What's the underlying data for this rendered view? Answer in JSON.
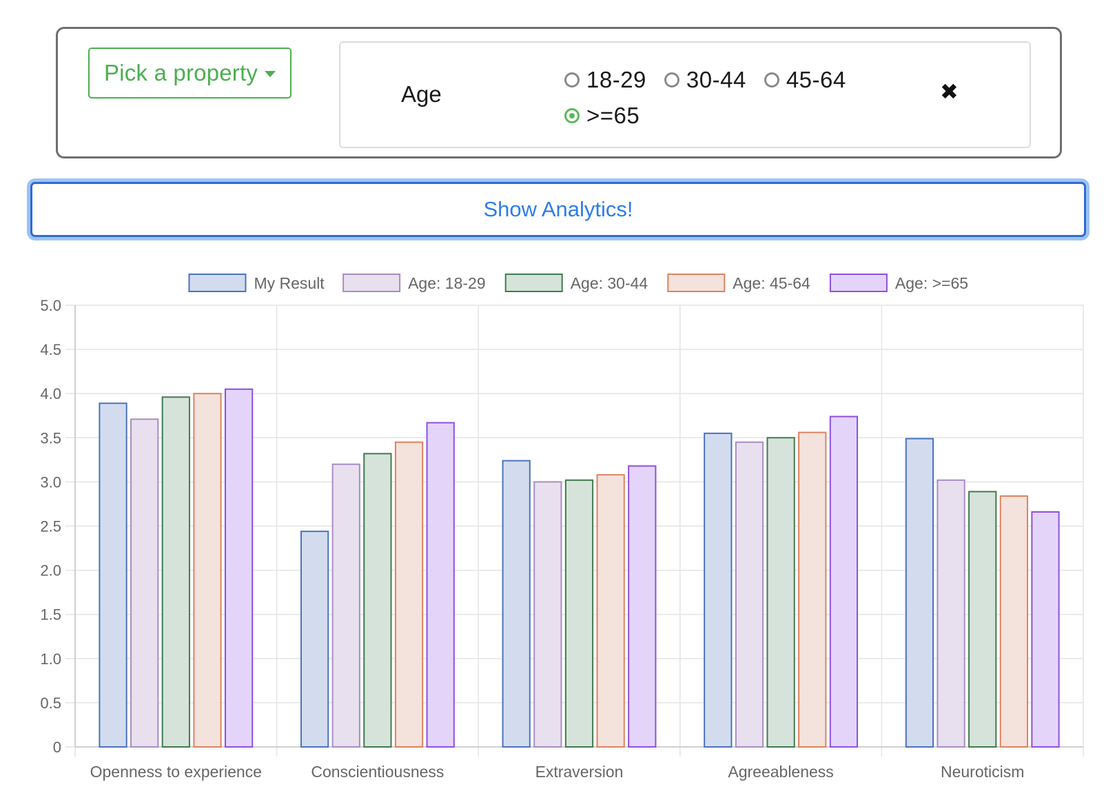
{
  "filter": {
    "pick_label": "Pick a property",
    "property_label": "Age",
    "options": [
      {
        "label": "18-29",
        "checked": false
      },
      {
        "label": "30-44",
        "checked": false
      },
      {
        "label": "45-64",
        "checked": false
      },
      {
        "label": ">=65",
        "checked": true
      }
    ],
    "close_glyph": "✖"
  },
  "analytics_button": "Show Analytics!",
  "chart_data": {
    "type": "bar",
    "categories": [
      "Openness to experience",
      "Conscientiousness",
      "Extraversion",
      "Agreeableness",
      "Neuroticism"
    ],
    "series": [
      {
        "name": "My Result",
        "values": [
          3.89,
          2.44,
          3.24,
          3.55,
          3.49
        ],
        "fill": "#d3dcee",
        "stroke": "#4a72c0"
      },
      {
        "name": "Age: 18-29",
        "values": [
          3.71,
          3.2,
          3.0,
          3.45,
          3.02
        ],
        "fill": "#e8e0ee",
        "stroke": "#a98cc4"
      },
      {
        "name": "Age: 30-44",
        "values": [
          3.96,
          3.32,
          3.02,
          3.5,
          2.89
        ],
        "fill": "#d6e3da",
        "stroke": "#3f7a4f"
      },
      {
        "name": "Age: 45-64",
        "values": [
          4.0,
          3.45,
          3.08,
          3.56,
          2.84
        ],
        "fill": "#f4e2dc",
        "stroke": "#dd8260"
      },
      {
        "name": "Age: >=65",
        "values": [
          4.05,
          3.67,
          3.18,
          3.74,
          2.66
        ],
        "fill": "#e4d4fa",
        "stroke": "#8e4fe0"
      }
    ],
    "ylim": [
      0,
      5
    ],
    "yticks": [
      "0",
      "0.5",
      "1.0",
      "1.5",
      "2.0",
      "2.5",
      "3.0",
      "3.5",
      "4.0",
      "4.5",
      "5.0"
    ],
    "grid": true,
    "legend_position": "top"
  }
}
